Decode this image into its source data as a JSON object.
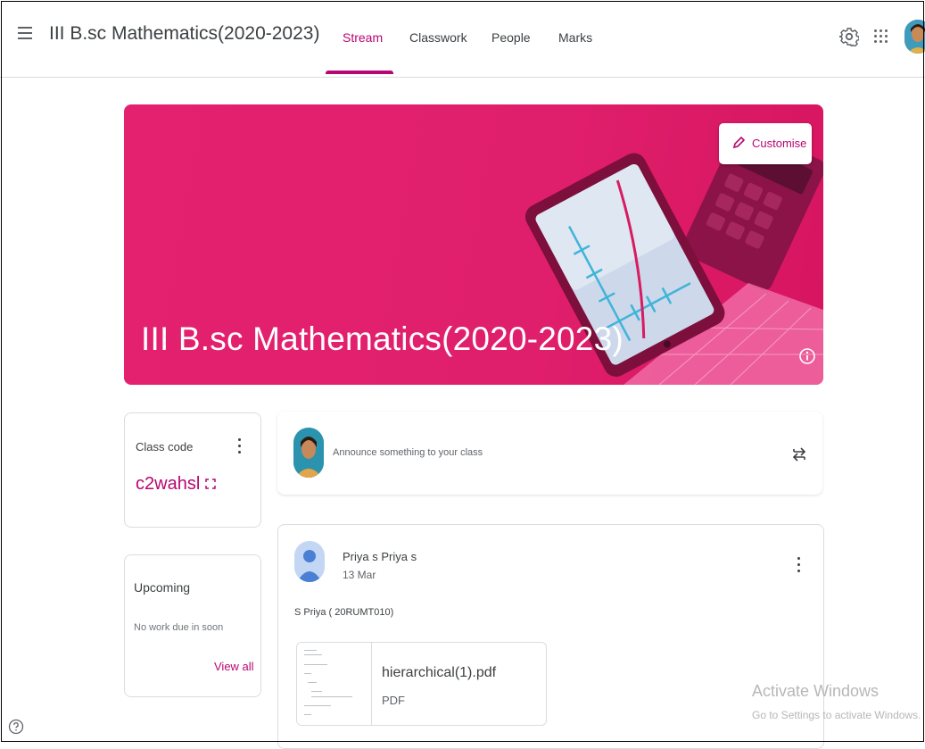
{
  "header": {
    "title": "III B.sc Mathematics(2020-2023)",
    "tabs": [
      {
        "label": "Stream"
      },
      {
        "label": "Classwork"
      },
      {
        "label": "People"
      },
      {
        "label": "Marks"
      }
    ],
    "active_tab": "Stream",
    "accent_color": "#b80672"
  },
  "banner": {
    "title": "III B.sc Mathematics(2020-2023)",
    "customise_label": "Customise",
    "color": "#e4216f"
  },
  "class_code": {
    "label": "Class code",
    "value": "c2wahsl"
  },
  "upcoming": {
    "title": "Upcoming",
    "text": "No work due in soon",
    "link": "View all"
  },
  "announce": {
    "placeholder": "Announce something to your class"
  },
  "post": {
    "author": "Priya s Priya s",
    "date": "13 Mar",
    "body": "S Priya ( 20RUMT010)",
    "attachment": {
      "name": "hierarchical(1).pdf",
      "type": "PDF"
    }
  },
  "watermark": {
    "line1": "Activate Windows",
    "line2": "Go to Settings to activate Windows."
  }
}
